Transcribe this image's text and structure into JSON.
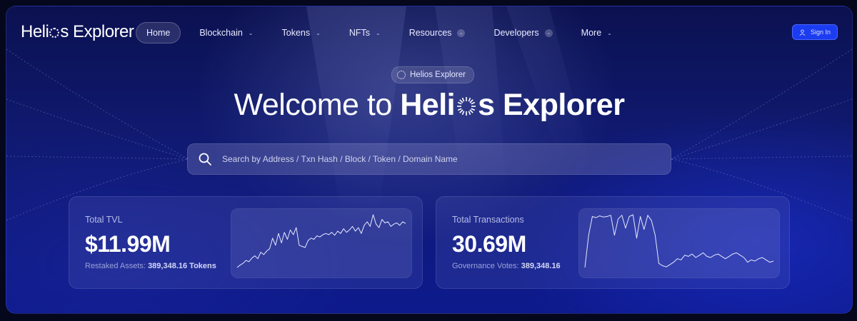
{
  "brand": {
    "name_pre": "Heli",
    "name_post": "s Explorer"
  },
  "nav": {
    "items": [
      {
        "label": "Home",
        "active": true,
        "dropdown": false
      },
      {
        "label": "Blockchain",
        "dropdown": true
      },
      {
        "label": "Tokens",
        "dropdown": true
      },
      {
        "label": "NFTs",
        "dropdown": true
      },
      {
        "label": "Resources",
        "dropdown": true
      },
      {
        "label": "Developers",
        "dropdown": true
      },
      {
        "label": "More",
        "dropdown": true
      }
    ],
    "signin_label": "Sign In",
    "accent": "#1b3cf0"
  },
  "hero": {
    "badge": "Helios Explorer",
    "title_pre": "Welcome to ",
    "title_brand_pre": "Heli",
    "title_brand_post": "s Explorer"
  },
  "search": {
    "placeholder": "Search by Address / Txn Hash / Block / Token / Domain Name"
  },
  "stats": {
    "tvl": {
      "label": "Total TVL",
      "value": "$11.99M",
      "sub_label": "Restaked Assets:",
      "sub_value": "389,348.16 Tokens",
      "spark": [
        2,
        6,
        9,
        14,
        12,
        18,
        22,
        17,
        28,
        24,
        30,
        34,
        52,
        40,
        60,
        44,
        62,
        50,
        66,
        58,
        70,
        40,
        38,
        36,
        48,
        52,
        50,
        56,
        54,
        58,
        60,
        58,
        62,
        57,
        64,
        60,
        68,
        62,
        66,
        72,
        64,
        70,
        60,
        74,
        80,
        72,
        92,
        76,
        70,
        84,
        78,
        80,
        72,
        76,
        78,
        74,
        80,
        77
      ]
    },
    "transactions": {
      "label": "Total Transactions",
      "value": "30.69M",
      "sub_label": "Governance Votes:",
      "sub_value": "389,348.16",
      "spark": [
        5,
        60,
        92,
        90,
        93,
        91,
        92,
        94,
        60,
        88,
        94,
        72,
        92,
        95,
        55,
        92,
        70,
        94,
        85,
        60,
        12,
        8,
        6,
        10,
        14,
        20,
        18,
        26,
        24,
        28,
        22,
        26,
        30,
        24,
        22,
        26,
        28,
        24,
        20,
        24,
        28,
        30,
        26,
        22,
        14,
        18,
        16,
        20,
        22,
        18,
        14,
        16
      ]
    }
  }
}
